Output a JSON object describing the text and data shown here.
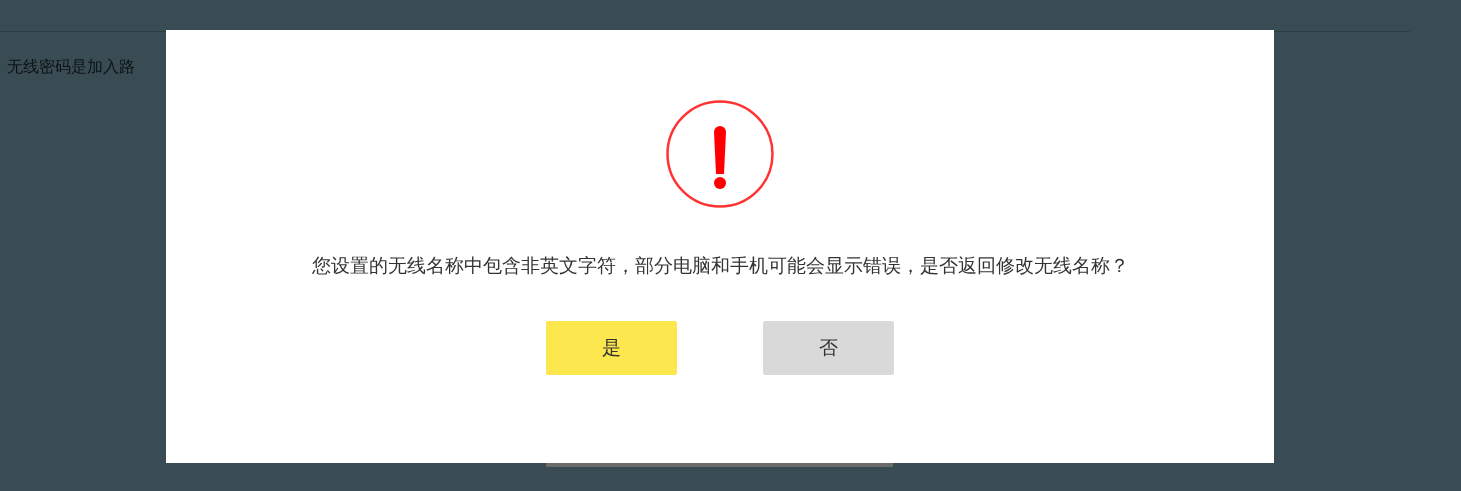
{
  "page": {
    "intro_text": "无线密码是加入路"
  },
  "dialog": {
    "message": "您设置的无线名称中包含非英文字符，部分电脑和手机可能会显示错误，是否返回修改无线名称？",
    "buttons": [
      {
        "label": "是",
        "kind": "primary"
      },
      {
        "label": "否",
        "kind": "secondary"
      }
    ]
  }
}
